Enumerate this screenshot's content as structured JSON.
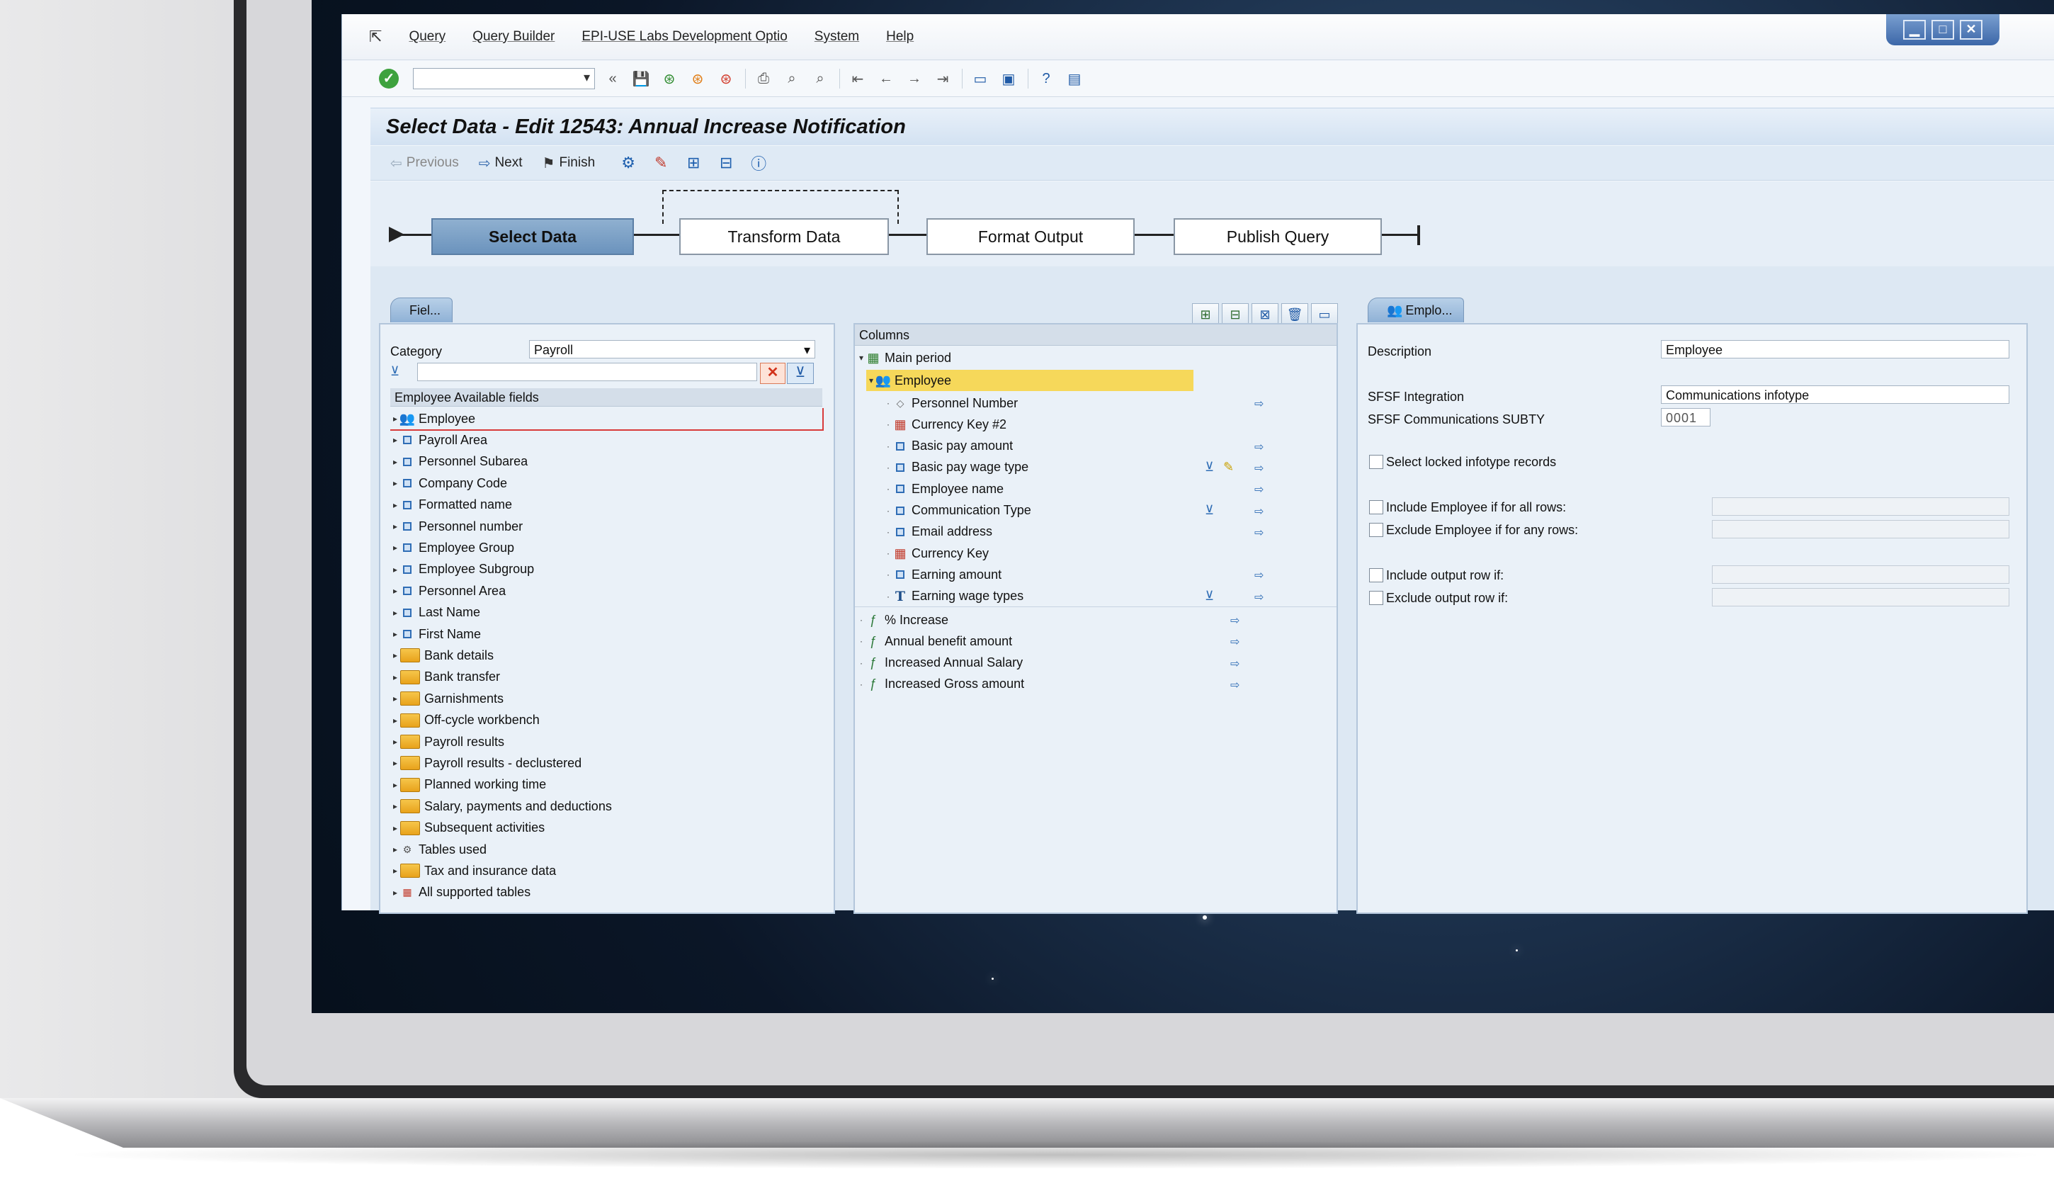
{
  "window": {
    "menu": [
      "Query",
      "Query Builder",
      "EPI-USE Labs Development Optio",
      "System",
      "Help"
    ],
    "controls": [
      "▁",
      "□",
      "✕"
    ]
  },
  "page_title": "Select Data - Edit 12543: Annual Increase Notification",
  "step_toolbar": {
    "previous": "Previous",
    "next": "Next",
    "finish": "Finish"
  },
  "roadmap": {
    "steps": [
      "Select Data",
      "Transform Data",
      "Format Output",
      "Publish Query"
    ],
    "active": 0
  },
  "left_panel": {
    "tab": "Fiel...",
    "category_label": "Category",
    "category_value": "Payroll",
    "tree_header": "Employee Available fields",
    "items": [
      {
        "label": "Employee",
        "icon": "employee-icon",
        "selected": true
      },
      {
        "label": "Payroll Area",
        "icon": "field-icon"
      },
      {
        "label": "Personnel Subarea",
        "icon": "field-icon"
      },
      {
        "label": "Company Code",
        "icon": "field-icon"
      },
      {
        "label": "Formatted name",
        "icon": "field-icon"
      },
      {
        "label": "Personnel number",
        "icon": "field-icon"
      },
      {
        "label": "Employee Group",
        "icon": "field-icon"
      },
      {
        "label": "Employee Subgroup",
        "icon": "field-icon"
      },
      {
        "label": "Personnel Area",
        "icon": "field-icon"
      },
      {
        "label": "Last Name",
        "icon": "field-icon"
      },
      {
        "label": "First Name",
        "icon": "field-icon"
      },
      {
        "label": "Bank details",
        "icon": "folder-icon"
      },
      {
        "label": "Bank transfer",
        "icon": "folder-icon"
      },
      {
        "label": "Garnishments",
        "icon": "folder-icon"
      },
      {
        "label": "Off-cycle workbench",
        "icon": "folder-icon"
      },
      {
        "label": "Payroll results",
        "icon": "folder-icon"
      },
      {
        "label": "Payroll results - declustered",
        "icon": "folder-icon"
      },
      {
        "label": "Planned working time",
        "icon": "folder-icon"
      },
      {
        "label": "Salary, payments and deductions",
        "icon": "folder-icon"
      },
      {
        "label": "Subsequent activities",
        "icon": "folder-icon"
      },
      {
        "label": "Tables used",
        "icon": "tables-icon"
      },
      {
        "label": "Tax and insurance data",
        "icon": "folder-icon"
      },
      {
        "label": "All supported tables",
        "icon": "all-tables-icon"
      }
    ]
  },
  "middle_panel": {
    "header": "Columns",
    "main_period": "Main period",
    "employee": "Employee",
    "employee_fields": [
      {
        "label": "Personnel Number",
        "icon": "key-field-icon",
        "filter": false,
        "extra": false
      },
      {
        "label": "Currency Key #2",
        "icon": "table-key-icon",
        "filter": false,
        "extra": false,
        "noout": true
      },
      {
        "label": "Basic pay amount",
        "icon": "field-icon",
        "filter": false,
        "extra": false
      },
      {
        "label": "Basic pay wage type",
        "icon": "field-icon",
        "filter": true,
        "extra": true
      },
      {
        "label": "Employee name",
        "icon": "field-icon",
        "filter": false,
        "extra": false
      },
      {
        "label": "Communication Type",
        "icon": "field-icon",
        "filter": true,
        "extra": false
      },
      {
        "label": "Email address",
        "icon": "field-icon",
        "filter": false,
        "extra": false
      },
      {
        "label": "Currency Key",
        "icon": "table-key-icon",
        "filter": false,
        "extra": false,
        "noout": true
      },
      {
        "label": "Earning amount",
        "icon": "field-icon",
        "filter": false,
        "extra": false
      },
      {
        "label": "Earning wage types",
        "icon": "text-icon",
        "filter": true,
        "extra": false
      }
    ],
    "calculated": [
      "% Increase",
      "Annual benefit amount",
      "Increased Annual Salary",
      "Increased Gross amount"
    ]
  },
  "right_panel": {
    "tab": "Emplo...",
    "description_label": "Description",
    "description_value": "Employee",
    "sfsf_integration_label": "SFSF Integration",
    "sfsf_integration_value": "Communications infotype",
    "sfsf_subty_label": "SFSF Communications SUBTY",
    "sfsf_subty_value": "0001",
    "cb_locked": "Select locked infotype records",
    "cb_include_emp": "Include Employee if for all rows:",
    "cb_exclude_emp": "Exclude Employee if for any rows:",
    "cb_include_row": "Include output row if:",
    "cb_exclude_row": "Exclude output row if:"
  }
}
